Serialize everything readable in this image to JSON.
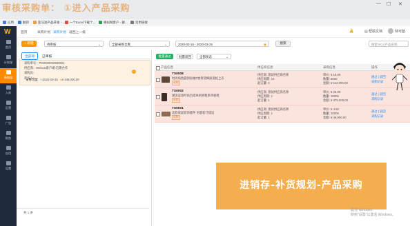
{
  "banner": {
    "title": "审核采购单：  ①进入产品采购"
  },
  "browser": {
    "bookmarks": [
      {
        "label": "应用",
        "color": "#4a7bd0"
      },
      {
        "label": "翻译",
        "color": "#2e7dd7"
      },
      {
        "label": "亚马逊产品开发 - ...",
        "color": "#e8a33d"
      },
      {
        "label": "一个Excel下载个...",
        "color": "#e34d3c"
      },
      {
        "label": "蝌蚪网客户 - 群...",
        "color": "#2c9e4f"
      },
      {
        "label": "常用链接",
        "color": "#777"
      }
    ]
  },
  "sidebar": {
    "logo": "W",
    "items": [
      {
        "label": "首页",
        "active": false
      },
      {
        "label": "计划部",
        "active": false
      },
      {
        "label": "采购部",
        "active": true
      },
      {
        "label": "入库",
        "active": false
      },
      {
        "label": "运营",
        "active": false
      },
      {
        "label": "广告",
        "active": false
      },
      {
        "label": "财务",
        "active": false
      },
      {
        "label": "应用",
        "active": false
      },
      {
        "label": "设置",
        "active": false
      }
    ]
  },
  "header": {
    "crumbs": [
      "首页",
      "采购计划",
      "采购计划",
      "返回上一级"
    ],
    "help": "帮助文档",
    "user": "林可歆"
  },
  "left": {
    "new_button": "+ 新建",
    "status_select": "待审核",
    "warehouse_select": "全部采购仓库",
    "date_range": "2020-03-16 - 2020-03-25",
    "search_button": "搜索",
    "tabs": [
      "全部单",
      "已审核"
    ],
    "order": {
      "no": "采购单号：PO2020032500001",
      "supplier": "供应商：Webcat客户端-近期合作",
      "memo": "采购员：",
      "remark": "审核人：",
      "creator": "林可歆",
      "date": "2020-03-25",
      "amount": "¥ 448,000.00"
    },
    "footer": "共 1 条"
  },
  "right": {
    "buttons": [
      "批量通过",
      "批量驳回",
      "全部状态"
    ],
    "search_placeholder": "搜索SKU/产品名称",
    "columns": [
      "产品信息",
      "供应商信息",
      "采购信息",
      "操作"
    ],
    "rows": [
      {
        "code": "TS0008",
        "name": "时尚纯色圆领短袖T恤男装棉质宽松上衣",
        "tag": "采购",
        "sup1": "供应商: 测试供应商名称",
        "sup2": "供应周期: 10",
        "sup3": "起订量: 2",
        "p1": "单价: ¥ 16.00",
        "p2": "数量: 8000",
        "p3": "金额: ¥ 112,000.00",
        "op1": "通过 | 驳回",
        "op2": "采购记录"
      },
      {
        "code": "TS0002",
        "name": "潮流运动时尚百搭休闲男鞋系带板鞋",
        "tag": "采购",
        "sup1": "供应商: 测试供应商名称",
        "sup2": "供应周期: 1",
        "sup3": "起订量: 1",
        "p1": "单价: ¥ 25.00",
        "p2": "数量: 15000",
        "p3": "金额: ¥ 375,000.00",
        "op1": "通过 | 驳回",
        "op2": "采购记录"
      },
      {
        "code": "TS0001",
        "name": "北欧家居装饰摆件 创意客厅摆设",
        "tag": "采购",
        "sup1": "供应商: 测试供应商名称",
        "sup2": "供应周期: 1",
        "sup3": "起订量: 1",
        "p1": "单价: ¥ 4.60",
        "p2": "数量: 10000",
        "p3": "金额: ¥ 46,000.00",
        "op1": "通过 | 驳回",
        "op2": "采购记录"
      }
    ]
  },
  "overlay": {
    "text": "进销存-补货规划-产品采购"
  },
  "watermark": {
    "line1": "激活 Windows",
    "line2": "转到“设置”以激活 Windows。"
  }
}
